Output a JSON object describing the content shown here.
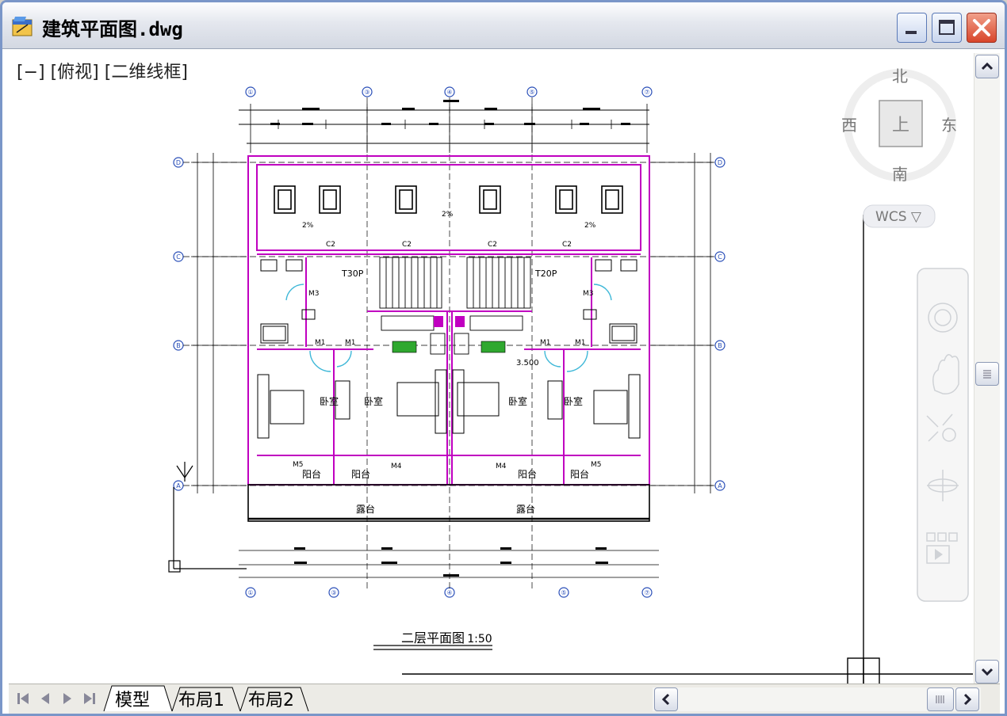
{
  "window": {
    "title": "建筑平面图.dwg",
    "controls": {
      "minimize": "_",
      "maximize": "□",
      "close": "X"
    }
  },
  "viewport": {
    "label": "[−] [俯视] [二维线框]",
    "viewcube": {
      "north": "北",
      "south": "南",
      "east": "东",
      "west": "西",
      "face": "上"
    },
    "wcs_label": "WCS ▽"
  },
  "drawing": {
    "title": "二层平面图",
    "scale": "1:50",
    "rooms": {
      "bedroom": "卧室",
      "balcony": "阳台",
      "terrace": "露台"
    },
    "stair_labels": [
      "T30P",
      "T20P"
    ],
    "window_labels": [
      "C2",
      "C2",
      "C2",
      "C2"
    ],
    "door_labels": [
      "M1",
      "M1",
      "M1",
      "M1",
      "M3",
      "M3",
      "M4",
      "M4",
      "M5",
      "M5"
    ],
    "slope_labels": [
      "2%",
      "2%",
      "2%"
    ],
    "elevation": "3.500",
    "axis_top": [
      "①",
      "③",
      "④",
      "⑤",
      "⑦"
    ],
    "axis_bottom": [
      "①",
      "③",
      "④",
      "⑤",
      "⑦"
    ],
    "axis_left": [
      "D",
      "C",
      "B",
      "A"
    ],
    "axis_right": [
      "D",
      "C",
      "B",
      "A"
    ]
  },
  "tabs": {
    "items": [
      "模型",
      "布局1",
      "布局2"
    ],
    "active": "模型"
  },
  "colors": {
    "wall": "#c000c0",
    "title_bar": "#e4e7ee",
    "frame": "#7a96c8",
    "close_button": "#d8452a",
    "green_fixture": "#2fa82f",
    "door_swing": "#3fb8d8"
  }
}
